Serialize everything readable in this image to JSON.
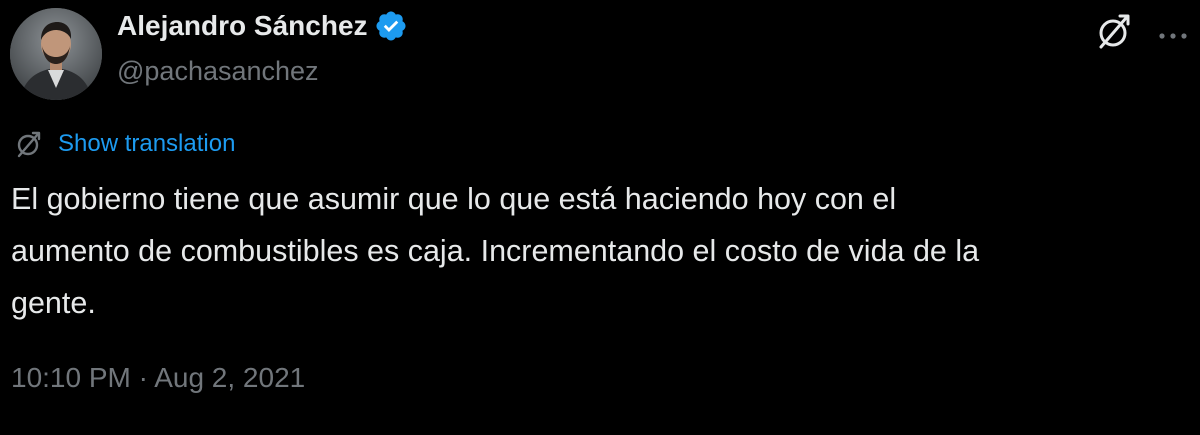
{
  "author": {
    "display_name": "Alejandro Sánchez",
    "handle": "@pachasanchez",
    "verified": true,
    "avatar_icon": "user-photo-avatar",
    "verified_icon": "verified-badge-icon"
  },
  "header_actions": {
    "translate_icon": "translate-icon",
    "more_icon": "more-options-icon"
  },
  "translation": {
    "icon": "translate-icon",
    "label": "Show translation"
  },
  "tweet": {
    "text": "El gobierno tiene que asumir que lo que está haciendo hoy con el\naumento de combustibles es caja. Incrementando el costo de vida de la\ngente.",
    "time": "10:10 PM",
    "separator": "·",
    "date": "Aug 2, 2021"
  },
  "colors": {
    "background": "#000000",
    "text_primary": "#e7e9ea",
    "text_secondary": "#71767b",
    "link": "#1d9bf0",
    "verified": "#1d9bf0"
  }
}
